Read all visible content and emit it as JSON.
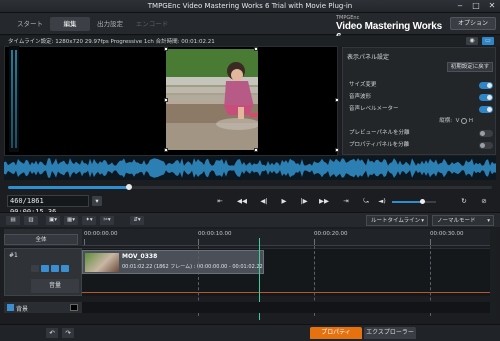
{
  "window": {
    "title": "TMPGEnc Video Mastering Works 6 Trial with Movie Plug-in"
  },
  "modes": [
    {
      "label": "スタート"
    },
    {
      "label": "編集"
    },
    {
      "label": "出力設定"
    },
    {
      "label": "エンコード"
    }
  ],
  "brand": {
    "small": "TMPGEnc",
    "big": "Video Mastering Works 6"
  },
  "option_label": "オプション",
  "timeline_info": "タイムライン設定: 1280x720 29.97fps Progressive 1ch 合計時間: 00:01:02.21",
  "panel": {
    "header": "表示パネル設定",
    "reset": "初期設定に戻す",
    "rows": [
      {
        "label": "サイズ変更",
        "on": true
      },
      {
        "label": "音声波形",
        "on": true
      },
      {
        "label": "音声レベルメーター",
        "on": true
      },
      {
        "label": "プレビューパネルを分離",
        "on": false
      },
      {
        "label": "プロパティパネルを分離",
        "on": false
      }
    ],
    "layout_label": "縦横:",
    "v": "V",
    "h": "H"
  },
  "progress": 0.25,
  "volume": 0.68,
  "transport": {
    "timecode": "460/1861  00:00:15.36"
  },
  "toolbar": {
    "route_label": "ルートタイムライン",
    "mode_label": "ノーマルモード"
  },
  "timeline": {
    "all_label": "全体",
    "ruler": [
      "00:00:00.00",
      "00:00:10.00",
      "00:00:20.00",
      "00:00:30.00"
    ],
    "track_label": "#1",
    "audio_label": "音量",
    "clip": {
      "name": "MOV_0338",
      "info": "00:01:02.22 (1862 フレーム) : 00:00:00.00 - 00:01:02.22"
    },
    "background_label": "背景"
  },
  "bottom_tabs": {
    "props": "プロパティ",
    "explorer": "エクスプローラー"
  }
}
